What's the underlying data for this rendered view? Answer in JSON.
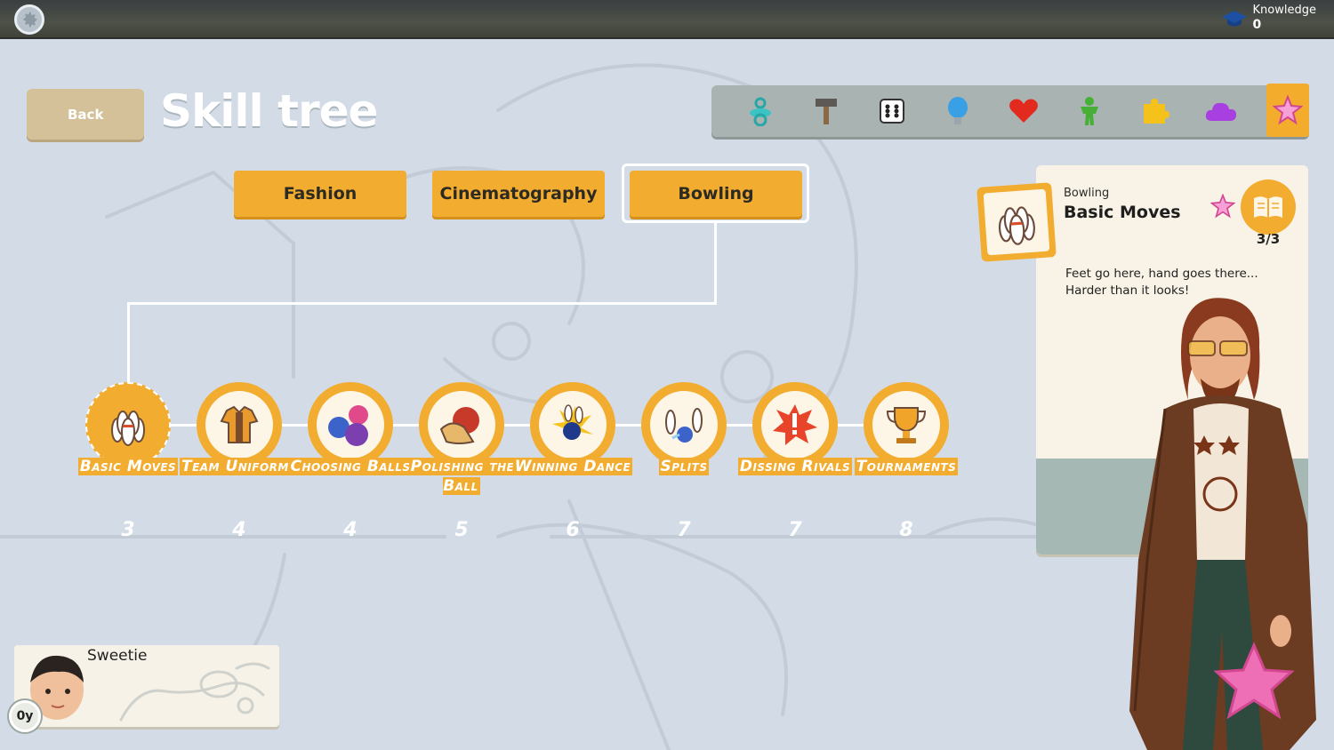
{
  "top_bar": {
    "settings_icon": "gear-icon",
    "knowledge_label": "Knowledge",
    "knowledge_value": "0"
  },
  "header": {
    "back_label": "Back",
    "title": "Skill tree"
  },
  "categories": [
    {
      "icon": "pacifier-icon",
      "active": false
    },
    {
      "icon": "hammer-icon",
      "active": false
    },
    {
      "icon": "dice-icon",
      "active": false
    },
    {
      "icon": "lightbulb-icon",
      "active": false
    },
    {
      "icon": "heart-icon",
      "active": false
    },
    {
      "icon": "person-icon",
      "active": false
    },
    {
      "icon": "puzzle-icon",
      "active": false
    },
    {
      "icon": "cloud-icon",
      "active": false
    },
    {
      "icon": "star-icon",
      "active": true
    }
  ],
  "tabs": [
    {
      "label": "Fashion"
    },
    {
      "label": "Cinematography"
    },
    {
      "label": "Bowling",
      "selected": true
    }
  ],
  "skills": [
    {
      "name": "Basic Moves",
      "cost": "3",
      "icon": "bowling-pins-icon"
    },
    {
      "name": "Team Uniforms",
      "cost": "4",
      "icon": "bowling-shirt-icon"
    },
    {
      "name": "Choosing Balls",
      "cost": "4",
      "icon": "bowling-balls-icon"
    },
    {
      "name": "Polishing the Ball",
      "cost": "5",
      "icon": "polish-ball-icon"
    },
    {
      "name": "Winning Dance",
      "cost": "6",
      "icon": "strike-icon"
    },
    {
      "name": "Splits",
      "cost": "7",
      "icon": "split-pins-icon"
    },
    {
      "name": "Dissing Rivals",
      "cost": "7",
      "icon": "shout-icon"
    },
    {
      "name": "Tournaments",
      "cost": "8",
      "icon": "trophy-icon"
    }
  ],
  "info_card": {
    "category": "Bowling",
    "title": "Basic Moves",
    "progress": "3/3",
    "description": "Feet go here, hand goes there... Harder than it looks!"
  },
  "child": {
    "name": "Sweetie",
    "age": "0y"
  },
  "colors": {
    "accent": "#f2ac2f",
    "background": "#d3dce6",
    "card": "#f8f3e6"
  }
}
